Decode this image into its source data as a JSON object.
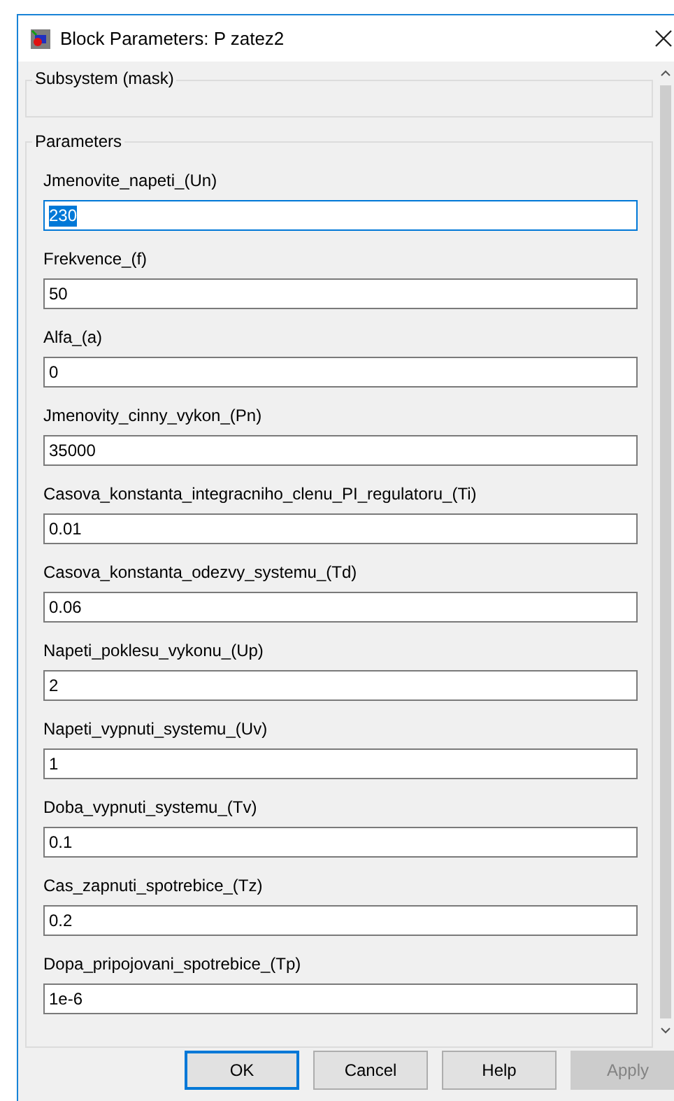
{
  "window": {
    "title": "Block Parameters: P zatez2"
  },
  "groups": [
    {
      "title": "Subsystem (mask)"
    },
    {
      "title": "Parameters"
    }
  ],
  "params": [
    {
      "label": "Jmenovite_napeti_(Un)",
      "value": "230",
      "focused": true
    },
    {
      "label": "Frekvence_(f)",
      "value": "50",
      "focused": false
    },
    {
      "label": "Alfa_(a)",
      "value": "0",
      "focused": false
    },
    {
      "label": "Jmenovity_cinny_vykon_(Pn)",
      "value": "35000",
      "focused": false
    },
    {
      "label": "Casova_konstanta_integracniho_clenu_PI_regulatoru_(Ti)",
      "value": "0.01",
      "focused": false
    },
    {
      "label": "Casova_konstanta_odezvy_systemu_(Td)",
      "value": "0.06",
      "focused": false
    },
    {
      "label": "Napeti_poklesu_vykonu_(Up)",
      "value": "2",
      "focused": false
    },
    {
      "label": "Napeti_vypnuti_systemu_(Uv)",
      "value": "1",
      "focused": false
    },
    {
      "label": "Doba_vypnuti_systemu_(Tv)",
      "value": "0.1",
      "focused": false
    },
    {
      "label": "Cas_zapnuti_spotrebice_(Tz)",
      "value": "0.2",
      "focused": false
    },
    {
      "label": "Dopa_pripojovani_spotrebice_(Tp)",
      "value": "1e-6",
      "focused": false
    }
  ],
  "buttons": [
    {
      "label": "OK",
      "default": true,
      "disabled": false
    },
    {
      "label": "Cancel",
      "default": false,
      "disabled": false
    },
    {
      "label": "Help",
      "default": false,
      "disabled": false
    },
    {
      "label": "Apply",
      "default": false,
      "disabled": true
    }
  ]
}
